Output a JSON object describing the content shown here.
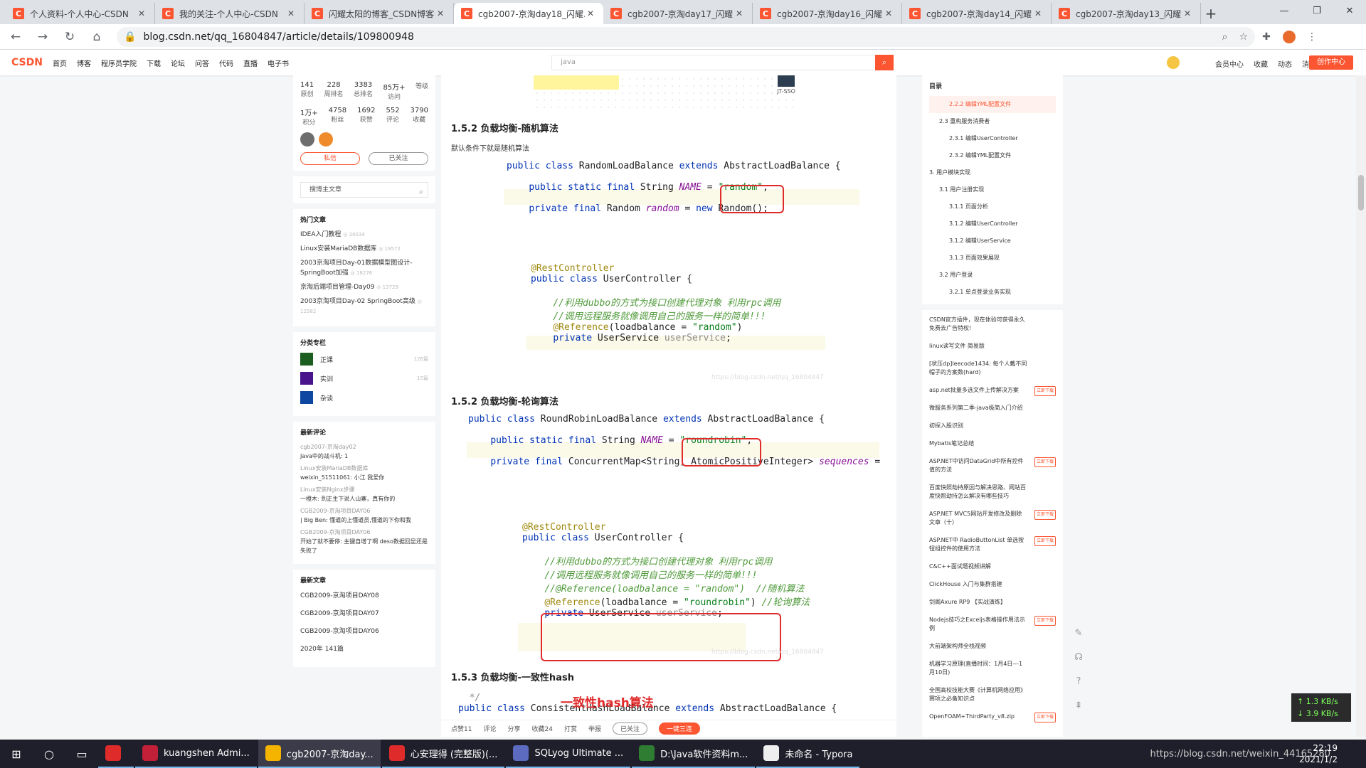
{
  "browser": {
    "tabs": [
      {
        "title": "个人资料-个人中心-CSDN",
        "active": false
      },
      {
        "title": "我的关注-个人中心-CSDN",
        "active": false
      },
      {
        "title": "闪耀太阳的博客_CSDN博客",
        "active": false
      },
      {
        "title": "cgb2007-京淘day18_闪耀...",
        "active": true
      },
      {
        "title": "cgb2007-京淘day17_闪耀...",
        "active": false
      },
      {
        "title": "cgb2007-京淘day16_闪耀...",
        "active": false
      },
      {
        "title": "cgb2007-京淘day14_闪耀...",
        "active": false
      },
      {
        "title": "cgb2007-京淘day13_闪耀...",
        "active": false
      }
    ],
    "url": "blog.csdn.net/qq_16804847/article/details/109800948"
  },
  "csdn_nav": {
    "logo": "CSDN",
    "items": [
      "首页",
      "博客",
      "程序员学院",
      "下载",
      "论坛",
      "问答",
      "代码",
      "直播",
      "电子书"
    ],
    "search_placeholder": "java",
    "right": [
      "会员中心",
      "收藏",
      "动态",
      "消息"
    ],
    "create": "创作中心"
  },
  "profile": {
    "stats_row1": [
      {
        "v": "141",
        "l": "原创"
      },
      {
        "v": "228",
        "l": "周排名"
      },
      {
        "v": "3383",
        "l": "总排名"
      },
      {
        "v": "85万+",
        "l": "访问"
      },
      {
        "v": "",
        "l": "等级"
      }
    ],
    "stats_row2": [
      {
        "v": "1万+",
        "l": "积分"
      },
      {
        "v": "4758",
        "l": "粉丝"
      },
      {
        "v": "1692",
        "l": "获赞"
      },
      {
        "v": "552",
        "l": "评论"
      },
      {
        "v": "3790",
        "l": "收藏"
      }
    ],
    "btn_msg": "私信",
    "btn_follow": "已关注",
    "search_placeholder": "搜博主文章"
  },
  "hot": {
    "title": "热门文章",
    "items": [
      {
        "t": "IDEA入门教程",
        "c": "20034"
      },
      {
        "t": "Linux安装MariaDB数据库",
        "c": "19572"
      },
      {
        "t": "2003京淘项目Day-01数据模型图设计-SpringBoot加强",
        "c": "18276"
      },
      {
        "t": "京淘后端项目管理-Day09",
        "c": "13729"
      },
      {
        "t": "2003京淘项目Day-02 SpringBoot高级",
        "c": "12582"
      }
    ]
  },
  "columns": {
    "title": "分类专栏",
    "items": [
      {
        "n": "正课",
        "c": "126篇"
      },
      {
        "n": "实训",
        "c": "15篇"
      },
      {
        "n": "杂谈",
        "c": ""
      }
    ]
  },
  "comments": {
    "title": "最新评论",
    "items": [
      {
        "a": "cgb2007-京淘day02",
        "t": "Java中的战斗机: 1"
      },
      {
        "a": "Linux安装MariaDB数据库",
        "t": "weixin_51511061: 小江 我爱你"
      },
      {
        "a": "Linux安装Nginx步骤",
        "t": "一橙木: 到正主下说人山寨，真有你的"
      },
      {
        "a": "CGB2009-京淘项目DAY06",
        "t": "| Big Ben: 懂道的上懂道员,懂道的下你和我"
      },
      {
        "a": "CGB2009-京淘项目DAY06",
        "t": "开始了就不要停: 主键自增了啊 deso数据回显还是失败了"
      }
    ]
  },
  "recent": {
    "title": "最新文章",
    "items": [
      "CGB2009-京淘项目DAY08",
      "CGB2009-京淘项目DAY07",
      "CGB2009-京淘项目DAY06"
    ],
    "archive": "2020年  141篇"
  },
  "article": {
    "top_label": "JT-SSO",
    "h_random": "1.5.2 负载均衡-随机算法",
    "p_random": "默认条件下就是随机算法",
    "h_round": "1.5.2 负载均衡-轮询算法",
    "h_hash": "1.5.3 负载均衡-一致性hash",
    "hash_red_title": "一致性hash算法",
    "watermark": "https://blog.csdn.net/qq_16804847"
  },
  "article_bar": [
    "点赞11",
    "评论",
    "分享",
    "收藏24",
    "打赏",
    "举报"
  ],
  "article_bar_btns": [
    "已关注",
    "一键三连"
  ],
  "toc": {
    "title": "目录",
    "items": [
      {
        "t": "2.2.2 编辑YML配置文件",
        "lvl": 3,
        "act": true
      },
      {
        "t": "2.3 重构服务消费者",
        "lvl": 2
      },
      {
        "t": "2.3.1 编辑UserController",
        "lvl": 3
      },
      {
        "t": "2.3.2 编辑YML配置文件",
        "lvl": 3
      },
      {
        "t": "3. 用户模块实现",
        "lvl": 1
      },
      {
        "t": "3.1 用户注册实现",
        "lvl": 2
      },
      {
        "t": "3.1.1 页面分析",
        "lvl": 3
      },
      {
        "t": "3.1.2 编辑UserController",
        "lvl": 3
      },
      {
        "t": "3.1.2 编辑UserService",
        "lvl": 3
      },
      {
        "t": "3.1.3 页面效果展现",
        "lvl": 3
      },
      {
        "t": "3.2 用户登录",
        "lvl": 2
      },
      {
        "t": "3.2.1 单点登录业务实现",
        "lvl": 3
      }
    ]
  },
  "recommend": [
    {
      "t": "CSDN官方插件，现在体验可获得永久免费去广告特权!",
      "d": ""
    },
    {
      "t": "linux读写文件 简易版",
      "d": ""
    },
    {
      "t": "[状压dp]leecode1434: 每个人戴不同帽子的方案数(hard)",
      "d": ""
    },
    {
      "t": "asp.net批量多选文件上传解决方案",
      "d": "立即下载"
    },
    {
      "t": "微服务系列第二季-java极简入门介绍",
      "d": ""
    },
    {
      "t": "初探入股识别",
      "d": ""
    },
    {
      "t": "Mybatis笔记总结",
      "d": ""
    },
    {
      "t": "ASP.NET中访问DataGrid中所有控件值的方法",
      "d": "立即下载"
    },
    {
      "t": "百度快照劫持原因与解决思路、网站百度快照劫持怎么解决有哪些技巧",
      "d": ""
    },
    {
      "t": "ASP.NET MVC5网站开发修改及删除文章（十）",
      "d": "立即下载"
    },
    {
      "t": "ASP.NET中 RadioButtonList 单选按钮组控件的使用方法",
      "d": "立即下载"
    },
    {
      "t": "C&C++面试题视频讲解",
      "d": ""
    },
    {
      "t": "ClickHouse 入门与集群搭建",
      "d": ""
    },
    {
      "t": "剑阁Axure RP9 【实战演练】",
      "d": ""
    },
    {
      "t": "Nodejs技巧之Exceljs表格操作用法示例",
      "d": "立即下载"
    },
    {
      "t": "大前端架构师全栈视频",
      "d": ""
    },
    {
      "t": "机器学习原理(直播时间：1月4日---1月10日)",
      "d": ""
    },
    {
      "t": "全国高校技能大赛《计算机网络应用》赛项之必备知识点",
      "d": ""
    },
    {
      "t": "OpenFOAM+ThirdParty_v8.zip",
      "d": "立即下载"
    }
  ],
  "side_icons": [
    "edit-icon",
    "headset-icon",
    "help-icon",
    "top-icon"
  ],
  "netspeed": {
    "up": "↑ 1.3 KB/s",
    "down": "↓ 3.9 KB/s"
  },
  "taskbar": {
    "apps": [
      {
        "label": "",
        "color": "#e02b2b",
        "active": false
      },
      {
        "label": "kuangshen Admi...",
        "color": "#c21f39",
        "active": false
      },
      {
        "label": "cgb2007-京淘day...",
        "color": "#f4b400",
        "active": true
      },
      {
        "label": "心安理得 (完整版)(...",
        "color": "#e02b2b",
        "active": false
      },
      {
        "label": "SQLyog Ultimate ...",
        "color": "#5c6bc0",
        "active": false
      },
      {
        "label": "D:\\Java软件资料m...",
        "color": "#2e7d32",
        "active": false
      },
      {
        "label": "未命名 - Typora",
        "color": "#eeeeee",
        "active": false
      }
    ],
    "time": "22:19",
    "date": "2021/1/2",
    "tray_text": "https://blog.csdn.net/weixin_44165280"
  }
}
